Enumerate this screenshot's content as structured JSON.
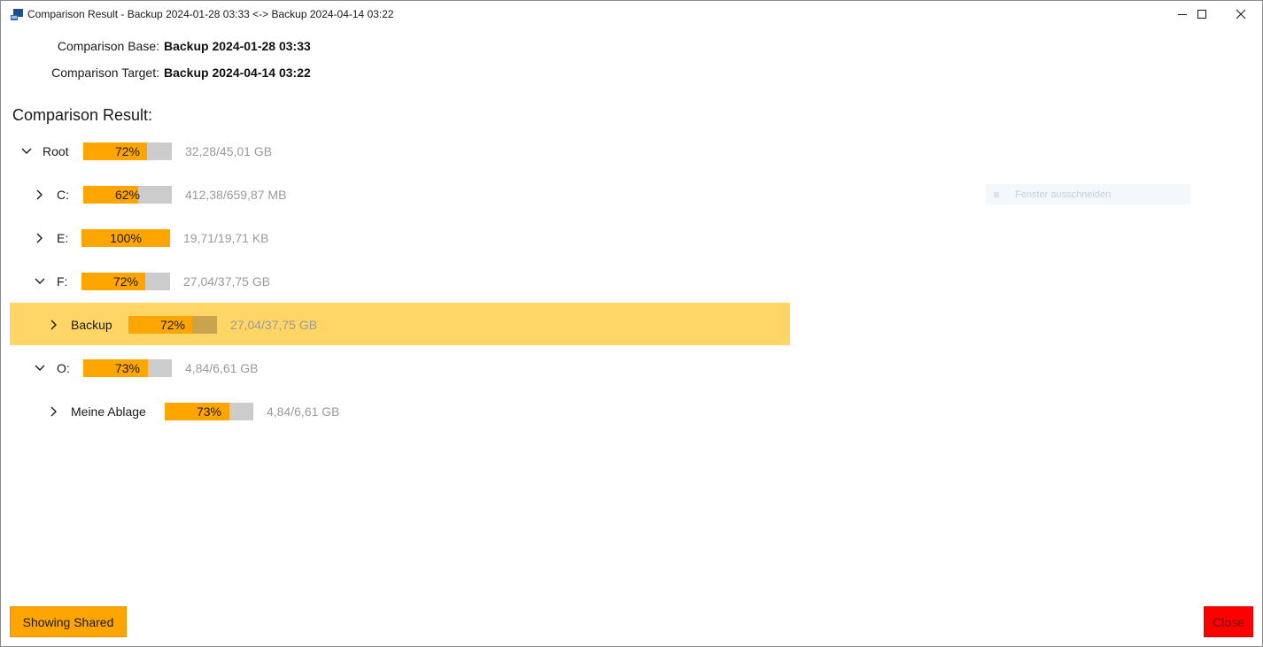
{
  "window": {
    "title": "Comparison Result - Backup 2024-01-28 03:33 <-> Backup 2024-04-14 03:22",
    "icon": "app-icon",
    "controls": [
      "minimize-icon",
      "maximize-icon",
      "close-icon"
    ]
  },
  "info": {
    "base_label": "Comparison Base:",
    "base_value": "Backup 2024-01-28 03:33",
    "target_label": "Comparison Target:",
    "target_value": "Backup 2024-04-14 03:22"
  },
  "section_title": "Comparison Result:",
  "tree": [
    {
      "label": "Root",
      "expanded": true,
      "percent_text": "72%",
      "fill_fraction": 0.72,
      "size": "32,28/45,01 GB"
    },
    {
      "label": "C:",
      "expanded": false,
      "percent_text": "62%",
      "fill_fraction": 0.62,
      "size": "412,38/659,87 MB"
    },
    {
      "label": "E:",
      "expanded": false,
      "percent_text": "100%",
      "fill_fraction": 1.0,
      "size": "19,71/19,71 KB"
    },
    {
      "label": "F:",
      "expanded": true,
      "percent_text": "72%",
      "fill_fraction": 0.72,
      "size": "27,04/37,75 GB"
    },
    {
      "label": "Backup",
      "expanded": false,
      "percent_text": "72%",
      "fill_fraction": 0.72,
      "size": "27,04/37,75 GB",
      "selected": true
    },
    {
      "label": "O:",
      "expanded": true,
      "percent_text": "73%",
      "fill_fraction": 0.73,
      "size": "4,84/6,61 GB"
    },
    {
      "label": "Meine Ablage",
      "expanded": false,
      "percent_text": "73%",
      "fill_fraction": 0.73,
      "size": "4,84/6,61 GB"
    }
  ],
  "ghost_overlay": {
    "text": "Fenster ausschneiden"
  },
  "buttons": {
    "showing_shared": "Showing Shared",
    "close": "Close"
  },
  "colors": {
    "bar_fill": "#ffa500",
    "bar_track": "#cccccc",
    "selection": "#ffd666",
    "close_button": "#ff0000"
  }
}
